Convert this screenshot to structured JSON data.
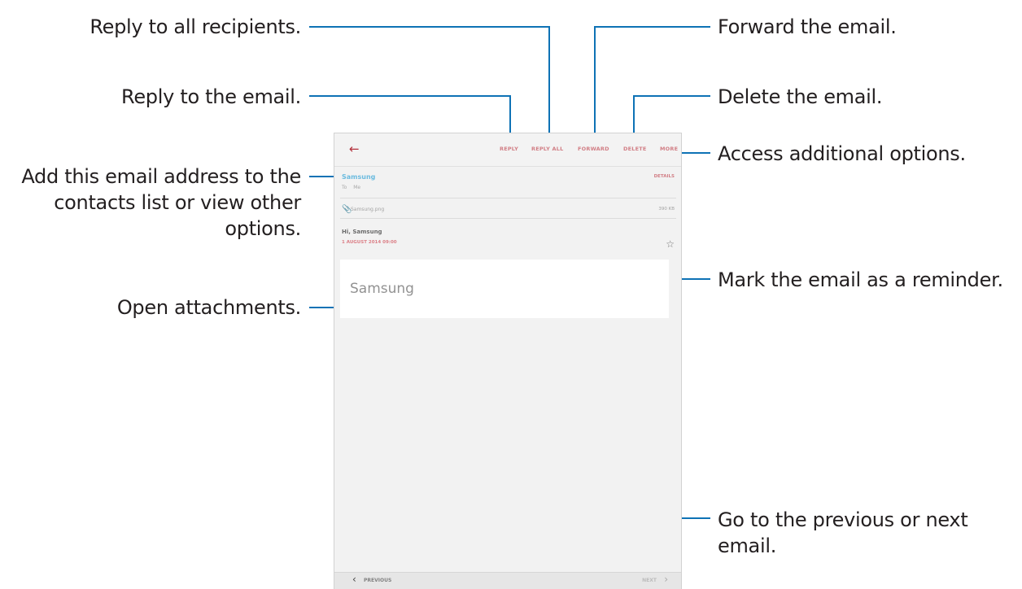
{
  "callouts": {
    "reply_all": "Reply to all recipients.",
    "reply": "Reply to the email.",
    "add_contact": [
      "Add this email address to the",
      "contacts list or view other",
      "options."
    ],
    "attachments": "Open attachments.",
    "forward": "Forward the email.",
    "delete": "Delete the email.",
    "more": "Access additional options.",
    "reminder": "Mark the email as a reminder.",
    "prev_next": [
      "Go to the previous or next",
      "email."
    ]
  },
  "screen": {
    "back_icon": "arrow-left-icon",
    "actions": {
      "reply": "REPLY",
      "reply_all": "REPLY ALL",
      "forward": "FORWARD",
      "delete": "DELETE",
      "more": "MORE"
    },
    "sender": "Samsung",
    "to_label": "To",
    "to_value": "Me",
    "details": "DETAILS",
    "attachment_icon": "paperclip-icon",
    "attachment_name": "Samsung.png",
    "attachment_size": "390 KB",
    "subject": "Hi, Samsung",
    "date": "1 AUGUST 2014 09:00",
    "star_icon": "star-outline-icon",
    "body_text": "Samsung",
    "nav": {
      "previous": "PREVIOUS",
      "next": "NEXT"
    }
  },
  "colors": {
    "accent": "#0e72b5",
    "brand_red": "#b3303b",
    "sender_blue": "#3fa9d9"
  }
}
